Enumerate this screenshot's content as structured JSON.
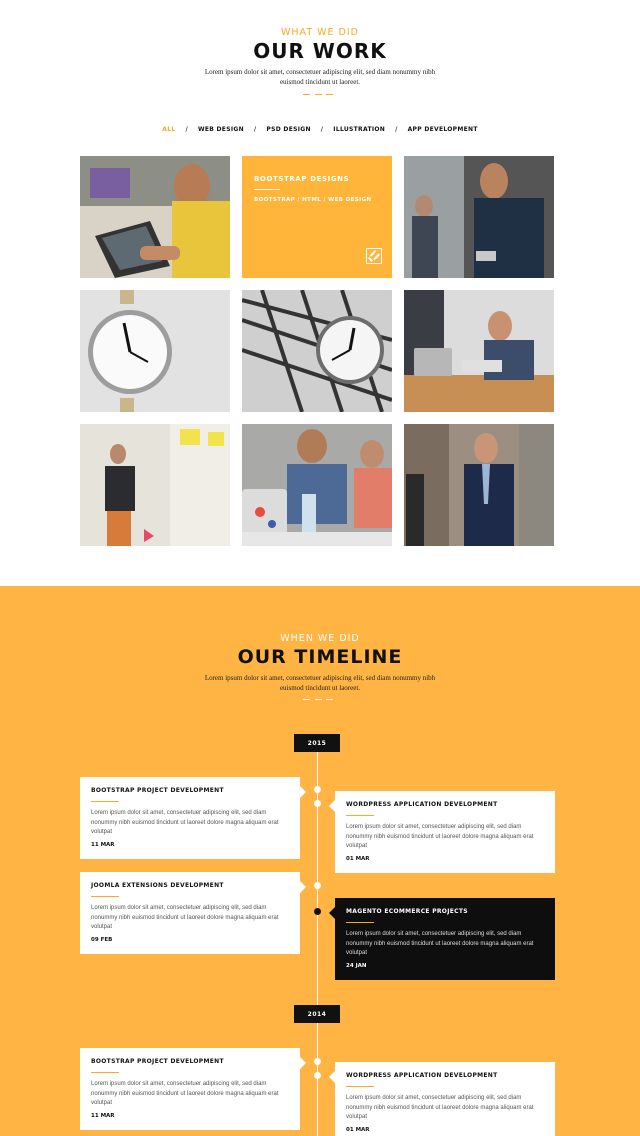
{
  "work": {
    "kicker": "WHAT WE DID",
    "title": "OUR WORK",
    "lead": "Lorem ipsum dolor sit amet, consectetuer adipiscing elit, sed diam nonummy nibh euismod tincidunt ut laoreet.",
    "filters": [
      {
        "label": "ALL",
        "active": true
      },
      {
        "label": "WEB DESIGN",
        "active": false
      },
      {
        "label": "PSD DESIGN",
        "active": false
      },
      {
        "label": "ILLUSTRATION",
        "active": false
      },
      {
        "label": "APP DEVELOPMENT",
        "active": false
      }
    ],
    "separator": "/",
    "featured": {
      "title": "BOOTSTRAP DESIGNS",
      "subtitle": "BOOTSTRAP / HTML / WEB DESIGN",
      "link_icon": "link-icon"
    }
  },
  "timeline": {
    "kicker": "WHEN WE DID",
    "title": "OUR TIMELINE",
    "lead": "Lorem ipsum dolor sit amet, consectetuer adipiscing elit, sed diam nonummy nibh euismod tincidunt ut laoreet.",
    "years": [
      "2015",
      "2014"
    ],
    "body": "Lorem ipsum dolor sit amet, consectetuer adipiscing elit, sed diam nonummy nibh euismod tincidunt ut laoreet dolore magna aliquam erat volutpat",
    "entries": [
      {
        "title": "BOOTSTRAP PROJECT DEVELOPMENT",
        "date": "11 MAR"
      },
      {
        "title": "WORDPRESS APPLICATION DEVELOPMENT",
        "date": "01 MAR"
      },
      {
        "title": "JOOMLA EXTENSIONS DEVELOPMENT",
        "date": "09 FEB"
      },
      {
        "title": "MAGENTO ECOMMERCE PROJECTS",
        "date": "24 JAN"
      },
      {
        "title": "BOOTSTRAP PROJECT DEVELOPMENT",
        "date": "11 MAR"
      },
      {
        "title": "WORDPRESS APPLICATION DEVELOPMENT",
        "date": "01 MAR"
      }
    ]
  },
  "colors": {
    "accent": "#f7a928",
    "timeline_bg": "#ffb444",
    "dark": "#0e0e0e"
  }
}
